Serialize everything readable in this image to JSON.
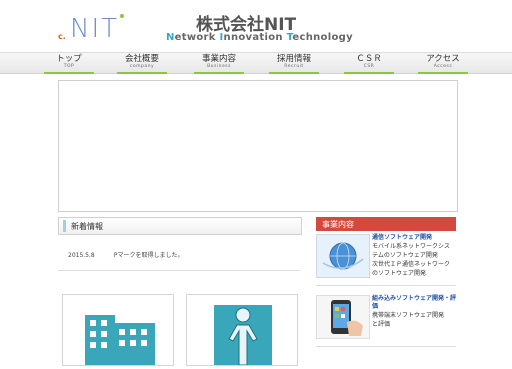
{
  "header": {
    "logo_c": "c.",
    "logo_text": "NIT",
    "company_name": "株式会社NIT",
    "tagline_parts": [
      {
        "cap": "N",
        "rest": "etwork "
      },
      {
        "cap": "I",
        "rest": "nnovation "
      },
      {
        "cap": "T",
        "rest": "echnology"
      }
    ]
  },
  "nav": {
    "items": [
      {
        "label": "トップ",
        "sub": "TOP"
      },
      {
        "label": "会社概要",
        "sub": "company"
      },
      {
        "label": "事業内容",
        "sub": "Business"
      },
      {
        "label": "採用情報",
        "sub": "Recruit"
      },
      {
        "label": "ＣＳＲ",
        "sub": "CSR"
      },
      {
        "label": "アクセス",
        "sub": "Access"
      }
    ]
  },
  "news": {
    "heading": "新着情報",
    "items": [
      {
        "date": "2015.5.8",
        "text": "Pマークを取得しました。"
      }
    ]
  },
  "side": {
    "heading": "事業内容",
    "items": [
      {
        "title": "通信ソフトウェア開発",
        "desc": [
          "モバイル系ネットワークシス",
          "テムのソフトウェア開発",
          "次世代ＩＰ通信ネットワーク",
          "のソフトウェア開発"
        ]
      },
      {
        "title": "組み込みソフトウェア開発・評価",
        "desc": [
          "携帯端末ソフトウェア開発",
          "と評価"
        ]
      }
    ]
  },
  "colors": {
    "accent_green": "#8cc63f",
    "side_heading": "#d24a3d",
    "link_blue": "#1e4fa3"
  }
}
